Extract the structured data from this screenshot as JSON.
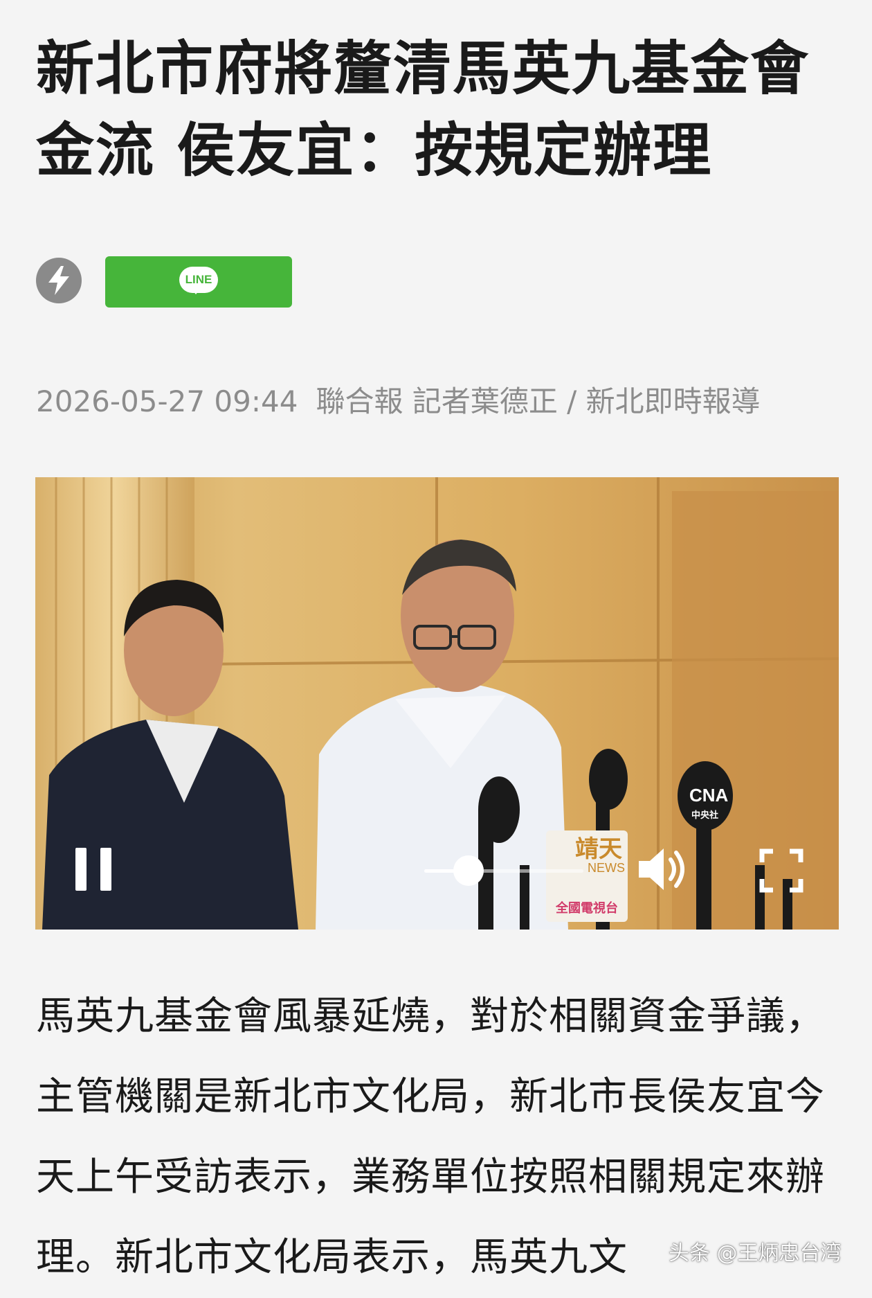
{
  "article": {
    "title": "新北市府將釐清馬英九基金會金流 侯友宜：按規定辦理",
    "date": "2026-05-27 09:44",
    "byline": "聯合報 記者葉德正 / 新北即時報導",
    "body": "馬英九基金會風暴延燒，對於相關資金爭議，主管機關是新北市文化局，新北市長侯友宜今天上午受訪表示，業務單位按照相關規定來辦理。新北市文化局表示，馬英九文"
  },
  "share": {
    "line_label": "LINE",
    "line_color": "#46b53a",
    "flash_icon": "lightning-bolt-icon"
  },
  "video": {
    "state": "playing",
    "progress": 0.28,
    "mic_labels": {
      "cna": "CNA",
      "cna_sub": "中央社",
      "jingtian": "靖天",
      "jingtian_en": "NEWS",
      "station": "全國電視台"
    }
  },
  "watermark": "头条 @王炳忠台湾"
}
